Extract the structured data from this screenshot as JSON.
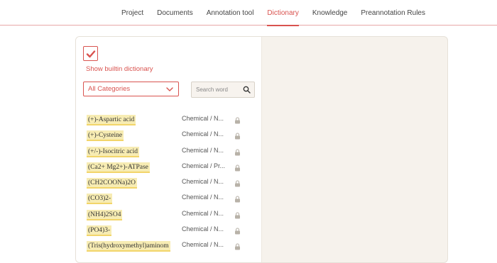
{
  "nav": {
    "tabs": [
      {
        "label": "Project"
      },
      {
        "label": "Documents"
      },
      {
        "label": "Annotation tool"
      },
      {
        "label": "Dictionary",
        "active": true
      },
      {
        "label": "Knowledge"
      },
      {
        "label": "Preannotation Rules"
      }
    ]
  },
  "dictionary": {
    "show_builtin_label": "Show builtin dictionary",
    "show_builtin_checked": true,
    "category_select": {
      "selected": "All Categories"
    },
    "search": {
      "placeholder": "Search word",
      "value": ""
    },
    "entries": [
      {
        "term": "(+)-Aspartic acid",
        "category": "Chemical / N..."
      },
      {
        "term": "(+)-Cysteine",
        "category": "Chemical / N..."
      },
      {
        "term": "(+/-)-Isocitric acid",
        "category": "Chemical / N..."
      },
      {
        "term": "(Ca2+ Mg2+)-ATPase",
        "category": "Chemical / Pr..."
      },
      {
        "term": "(CH2COONa)2O",
        "category": "Chemical / N..."
      },
      {
        "term": "(CO3)2-",
        "category": "Chemical / N..."
      },
      {
        "term": "(NH4)2SO4",
        "category": "Chemical / N..."
      },
      {
        "term": "(PO4)3-",
        "category": "Chemical / N..."
      },
      {
        "term": "(Tris(hydroxymethyl)aminom",
        "category": "Chemical / N..."
      }
    ]
  },
  "colors": {
    "accent": "#d9534f",
    "highlight": "#f7ecb3",
    "panel_bg": "#f6f2ec"
  },
  "icons": {
    "check": "check-icon",
    "chevron": "chevron-down-icon",
    "search": "search-icon",
    "lock": "lock-icon"
  }
}
